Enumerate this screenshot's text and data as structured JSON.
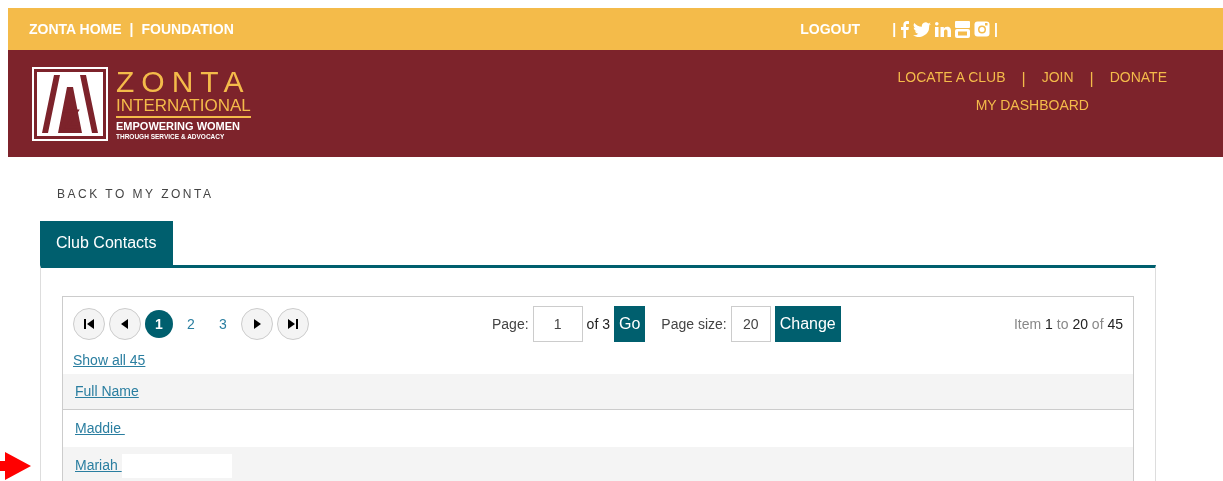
{
  "top_bar": {
    "links": [
      "ZONTA HOME",
      "FOUNDATION"
    ],
    "separator": "|",
    "logout": "LOGOUT",
    "social_separator": "|"
  },
  "header": {
    "logo": {
      "name": "ZONTA",
      "subtitle": "INTERNATIONAL",
      "tagline": "EMPOWERING WOMEN",
      "tagline_small": "THROUGH SERVICE & ADVOCACY"
    },
    "nav": [
      {
        "label": "LOCATE A CLUB"
      },
      {
        "label": "JOIN"
      },
      {
        "label": "DONATE"
      },
      {
        "label": "MY DASHBOARD"
      }
    ],
    "nav_separator": "|"
  },
  "back_link": "BACK TO MY ZONTA",
  "tabs": [
    {
      "label": "Club Contacts",
      "selected": true
    }
  ],
  "pager": {
    "pages": [
      {
        "label": "1",
        "selected": true
      },
      {
        "label": "2",
        "selected": false
      },
      {
        "label": "3",
        "selected": false
      }
    ],
    "page_label": "Page:",
    "page_value": "1",
    "of_text": "of 3",
    "go": "Go",
    "size_label": "Page size:",
    "size_value": "20",
    "change": "Change",
    "summary": "Item **1** to **20** of **45**",
    "show_all": "Show all 45"
  },
  "table": {
    "columns": [
      "Full Name"
    ],
    "rows": [
      {
        "name": "Maddie"
      },
      {
        "name": "Mariah",
        "redacted": true,
        "arrow": true
      }
    ]
  }
}
